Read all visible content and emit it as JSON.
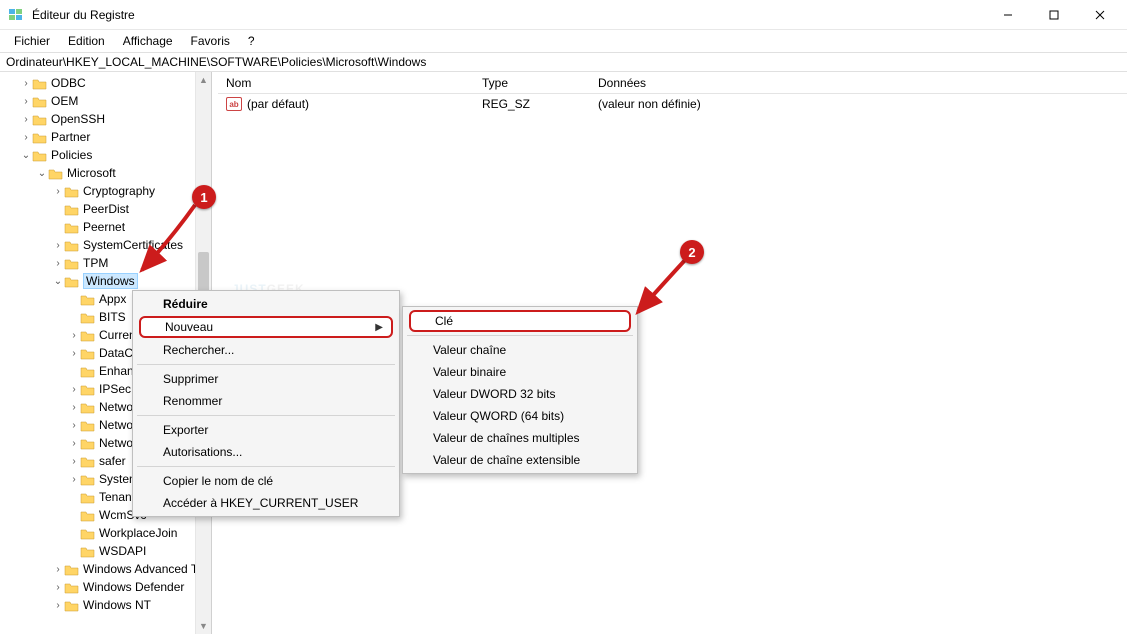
{
  "window": {
    "title": "Éditeur du Registre"
  },
  "menu": {
    "file": "Fichier",
    "edit": "Edition",
    "view": "Affichage",
    "fav": "Favoris",
    "help": "?"
  },
  "address": "Ordinateur\\HKEY_LOCAL_MACHINE\\SOFTWARE\\Policies\\Microsoft\\Windows",
  "columns": {
    "name": "Nom",
    "type": "Type",
    "data": "Données"
  },
  "row": {
    "name": "(par défaut)",
    "type": "REG_SZ",
    "data": "(valeur non définie)"
  },
  "tree": {
    "odbc": "ODBC",
    "oem": "OEM",
    "openssh": "OpenSSH",
    "partner": "Partner",
    "policies": "Policies",
    "microsoft": "Microsoft",
    "crypt": "Cryptography",
    "peerdist": "PeerDist",
    "peernet": "Peernet",
    "syscert": "SystemCertificates",
    "tpm": "TPM",
    "windows": "Windows",
    "appx": "Appx",
    "bits": "BITS",
    "curren": "Curren",
    "dataco": "DataCo",
    "enhan": "Enhan",
    "ipsec": "IPSec",
    "netwo1": "Netwo",
    "netwo2": "Netwo",
    "netwo3": "Netwo",
    "safer": "safer",
    "system": "System",
    "tenant": "Tenant",
    "wcmsvc": "WcmSvc",
    "workplace": "WorkplaceJoin",
    "wsdapi": "WSDAPI",
    "winadv": "Windows Advanced T",
    "windef": "Windows Defender",
    "winnt": "Windows NT"
  },
  "ctx1": {
    "reduce": "Réduire",
    "nouveau": "Nouveau",
    "find": "Rechercher...",
    "delete": "Supprimer",
    "rename": "Renommer",
    "export": "Exporter",
    "perm": "Autorisations...",
    "copykey": "Copier le nom de clé",
    "goto": "Accéder à HKEY_CURRENT_USER"
  },
  "ctx2": {
    "cle": "Clé",
    "vchaine": "Valeur chaîne",
    "vbin": "Valeur binaire",
    "vdword": "Valeur DWORD 32 bits",
    "vqword": "Valeur QWORD (64 bits)",
    "vmulti": "Valeur de chaînes multiples",
    "vext": "Valeur de chaîne extensible"
  },
  "markers": {
    "one": "1",
    "two": "2"
  },
  "watermark": {
    "a": "JUST",
    "b": "GEEK"
  }
}
